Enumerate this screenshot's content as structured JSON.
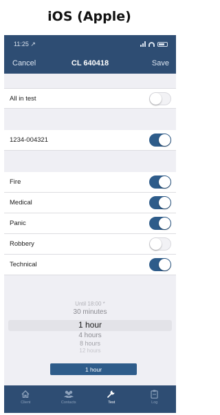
{
  "heading": "iOS (Apple)",
  "status": {
    "time": "11:25 ↗"
  },
  "nav": {
    "cancel_label": "Cancel",
    "title": "CL 640418",
    "save_label": "Save"
  },
  "settings": {
    "all_in_test": {
      "label": "All in test",
      "on": false
    },
    "device": {
      "label": "1234-004321",
      "on": true
    },
    "signals": [
      {
        "label": "Fire",
        "on": true
      },
      {
        "label": "Medical",
        "on": true
      },
      {
        "label": "Panic",
        "on": true
      },
      {
        "label": "Robbery",
        "on": false
      },
      {
        "label": "Technical",
        "on": true
      }
    ]
  },
  "duration_picker": {
    "options": [
      "Until 18:00 *",
      "30 minutes",
      "1 hour",
      "4 hours",
      "8 hours",
      "12 hours"
    ],
    "selected": "1 hour"
  },
  "confirm_button_label": "1 hour",
  "tabs": [
    {
      "label": "Client",
      "icon": "home-icon",
      "active": false
    },
    {
      "label": "Contacts",
      "icon": "people-icon",
      "active": false
    },
    {
      "label": "Test",
      "icon": "wrench-icon",
      "active": true
    },
    {
      "label": "Log",
      "icon": "clipboard-icon",
      "active": false
    }
  ],
  "colors": {
    "bar": "#2e4d73",
    "toggle_on": "#2e5c8a",
    "background": "#efeff4"
  }
}
